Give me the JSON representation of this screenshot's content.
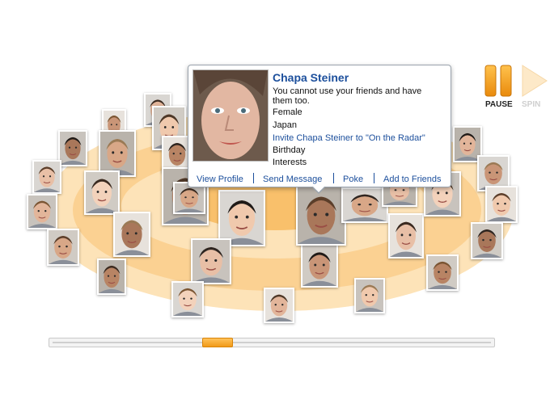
{
  "popup": {
    "name": "Chapa Steiner",
    "message": "You cannot use your friends and have them too.",
    "gender": "Female",
    "location": "Japan",
    "invite_link": "Invite Chapa Steiner to \"On the Radar\"",
    "birthday_label": "Birthday",
    "interests_label": "Interests",
    "actions": [
      "View Profile",
      "Send Message",
      "Poke",
      "Add to Friends"
    ],
    "link_color": "#1c4f9c"
  },
  "controls": {
    "pause_label": "PAUSE",
    "spin_label": "SPIN",
    "pause_state": "active",
    "spin_state": "disabled",
    "accent": "#f39b1c"
  },
  "slider": {
    "position": 0.37
  },
  "carousel": {
    "photo_count": 36,
    "ring_colors": [
      "#fde3b8",
      "#fbd192",
      "#f7b04a"
    ]
  }
}
